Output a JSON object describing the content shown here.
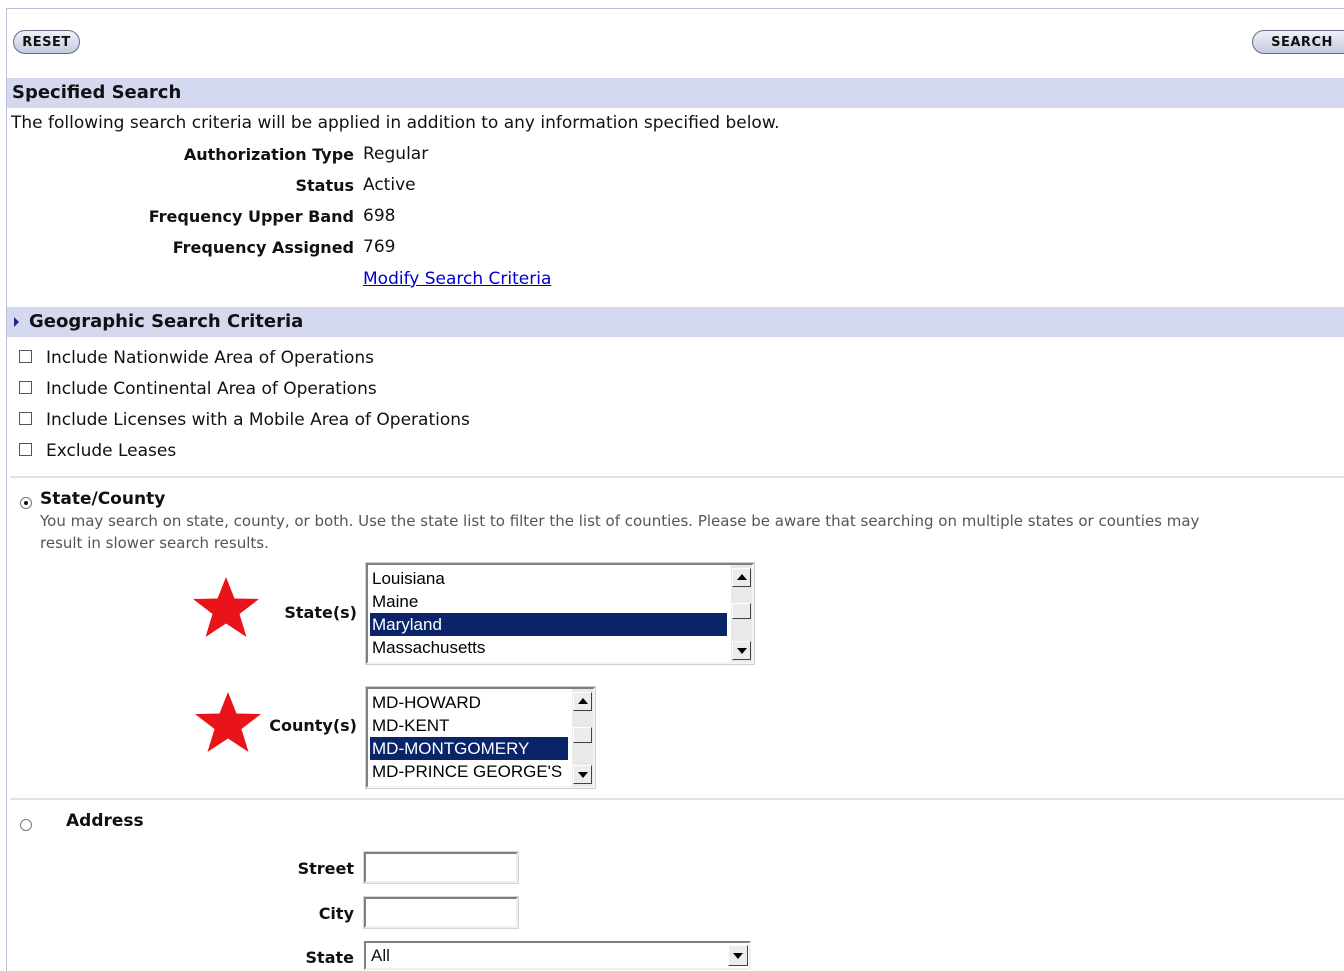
{
  "toolbar": {
    "reset_label": "RESET",
    "search_label": "SEARCH"
  },
  "specified": {
    "title": "Specified Search",
    "intro": "The following search criteria will be applied in addition to any information specified below.",
    "rows": [
      {
        "label": "Authorization Type",
        "value": "Regular"
      },
      {
        "label": "Status",
        "value": "Active"
      },
      {
        "label": "Frequency Upper Band",
        "value": "698"
      },
      {
        "label": "Frequency Assigned",
        "value": "769"
      }
    ],
    "modify_link": "Modify Search Criteria"
  },
  "geo": {
    "title": "Geographic Search Criteria",
    "checkboxes": [
      {
        "label": "Include Nationwide Area of Operations",
        "checked": false
      },
      {
        "label": "Include Continental Area of Operations",
        "checked": false
      },
      {
        "label": "Include Licenses with a Mobile Area of Operations",
        "checked": false
      },
      {
        "label": "Exclude Leases",
        "checked": false
      }
    ],
    "state_county": {
      "label": "State/County",
      "selected": true,
      "help": "You may search on state, county, or both. Use the state list to filter the list of counties. Please be aware that searching on multiple states or counties may",
      "help2": "result in slower search results.",
      "states_label": "State(s)",
      "states": [
        "Louisiana",
        "Maine",
        "Maryland",
        "Massachusetts"
      ],
      "states_selected": "Maryland",
      "counties_label": "County(s)",
      "counties": [
        "MD-HOWARD",
        "MD-KENT",
        "MD-MONTGOMERY",
        "MD-PRINCE GEORGE'S"
      ],
      "counties_selected": "MD-MONTGOMERY"
    },
    "address": {
      "label": "Address",
      "selected": false,
      "street_label": "Street",
      "street_value": "",
      "city_label": "City",
      "city_value": "",
      "state_label": "State",
      "state_value": "All"
    }
  },
  "annotation_color": "#e8141a",
  "selection_color": "#0a246a",
  "band_color": "#d4d9f0"
}
